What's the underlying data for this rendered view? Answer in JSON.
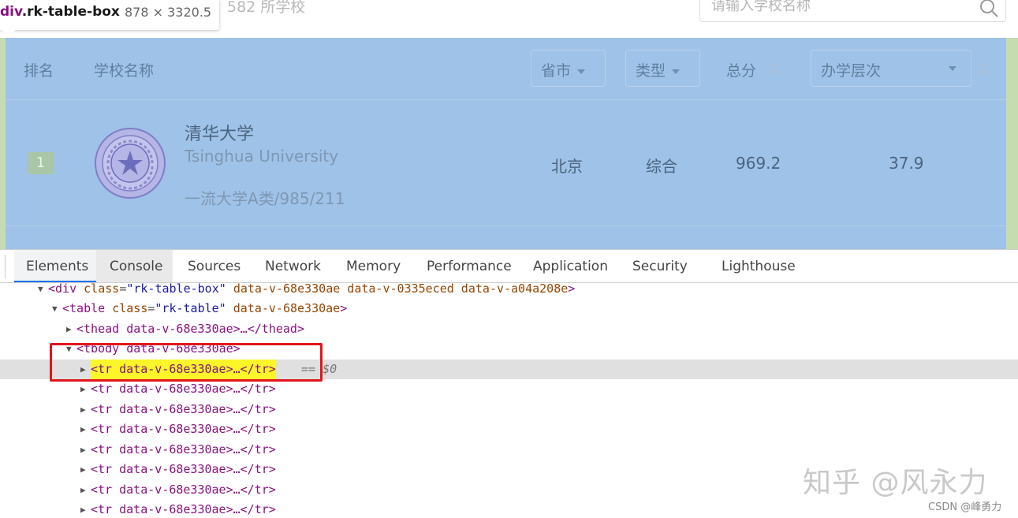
{
  "tooltip": {
    "selector_tag": "div",
    "selector_class": ".rk-table-box",
    "size": "878 × 3320.5"
  },
  "page": {
    "count_text": "582 所学校",
    "search_placeholder": "请输入学校名称",
    "icon": "search-icon"
  },
  "table": {
    "headers": {
      "rank": "排名",
      "name": "学校名称",
      "province": "省市",
      "type": "类型",
      "score": "总分",
      "level": "办学层次"
    },
    "rows": [
      {
        "rank": "1",
        "name_cn": "清华大学",
        "name_en": "Tsinghua University",
        "tags": "一流大学A类/985/211",
        "province": "北京",
        "type": "综合",
        "score": "969.2",
        "level": "37.9"
      }
    ],
    "colors": {
      "highlight": "#9fc2e8",
      "margin": "#c5dcb0"
    }
  },
  "devtools": {
    "tabs": [
      "Elements",
      "Console",
      "Sources",
      "Network",
      "Memory",
      "Performance",
      "Application",
      "Security",
      "Lighthouse"
    ],
    "active_tab": "Elements",
    "dom": {
      "div_tag": "div",
      "div_class_attr": "class",
      "div_class_val": "\"rk-table-box\"",
      "div_attrs": "data-v-68e330ae data-v-0335eced data-v-a04a208e",
      "table_tag": "table",
      "table_class_val": "\"rk-table\"",
      "table_attr": "data-v-68e330ae",
      "thead_text": "<thead data-v-68e330ae>…</thead>",
      "tbody_text": "<tbody data-v-68e330ae>",
      "tr_text": "<tr data-v-68e330ae>…</tr>",
      "selected_suffix": "== $0"
    }
  },
  "watermark": "知乎 @风永力",
  "csdn_credit": "CSDN @峰勇力"
}
